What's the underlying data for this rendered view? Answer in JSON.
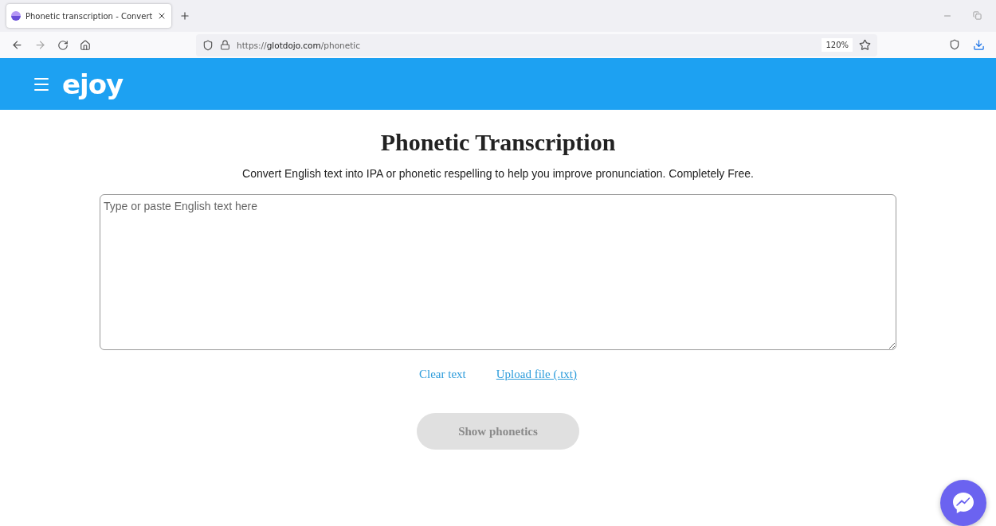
{
  "browser": {
    "tab": {
      "title": "Phonetic transcription - Convert",
      "selected": true
    },
    "url": "https://**glotdojo.com**/phonetic",
    "zoom": "120%"
  },
  "header": {
    "logo": "ejoy"
  },
  "main": {
    "title": "Phonetic Transcription",
    "subtitle": "Convert English text into IPA or phonetic respelling to help you improve pronunciation. Completely Free.",
    "input": {
      "placeholder": "Type or paste English text here"
    },
    "links": [
      "Clear text",
      "Upload file (.txt)"
    ],
    "button": {
      "label": "Show phonetics",
      "disabled": true
    }
  }
}
